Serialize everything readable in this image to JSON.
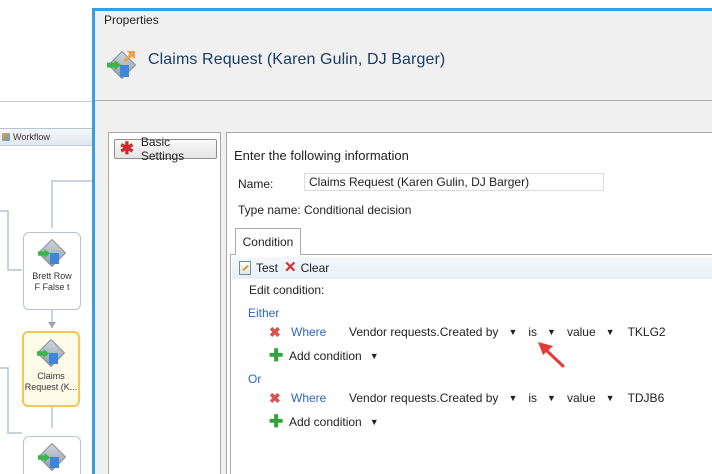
{
  "background": {
    "panel_title": "Workflow",
    "nodes": [
      {
        "line1": "Brett Row",
        "line2": "F False t"
      },
      {
        "line1": "Claims",
        "line2": "Request (K..."
      }
    ]
  },
  "dialog": {
    "window_title": "Properties",
    "heading": "Claims Request (Karen Gulin, DJ Barger)",
    "sidebar": {
      "basic_settings_label": "Basic Settings"
    },
    "intro": "Enter the following information",
    "name_label": "Name:",
    "name_value": "Claims Request (Karen Gulin, DJ Barger)",
    "type_label": "Type name:",
    "type_value": "Conditional decision",
    "tab_label": "Condition",
    "toolbar": {
      "test_label": "Test",
      "clear_label": "Clear"
    },
    "edit_condition_label": "Edit condition:",
    "groups": [
      {
        "label": "Either",
        "condition": {
          "where_label": "Where",
          "field": "Vendor requests.Created by",
          "operator": "is",
          "value_type": "value",
          "value": "TKLG2"
        },
        "add_label": "Add condition"
      },
      {
        "label": "Or",
        "condition": {
          "where_label": "Where",
          "field": "Vendor requests.Created by",
          "operator": "is",
          "value_type": "value",
          "value": "TDJB6"
        },
        "add_label": "Add condition"
      }
    ]
  },
  "colors": {
    "accent_blue": "#2b66c9",
    "heading_blue": "#1a3d66",
    "annotation_red": "#e53935",
    "window_border": "#3c9ed8"
  }
}
